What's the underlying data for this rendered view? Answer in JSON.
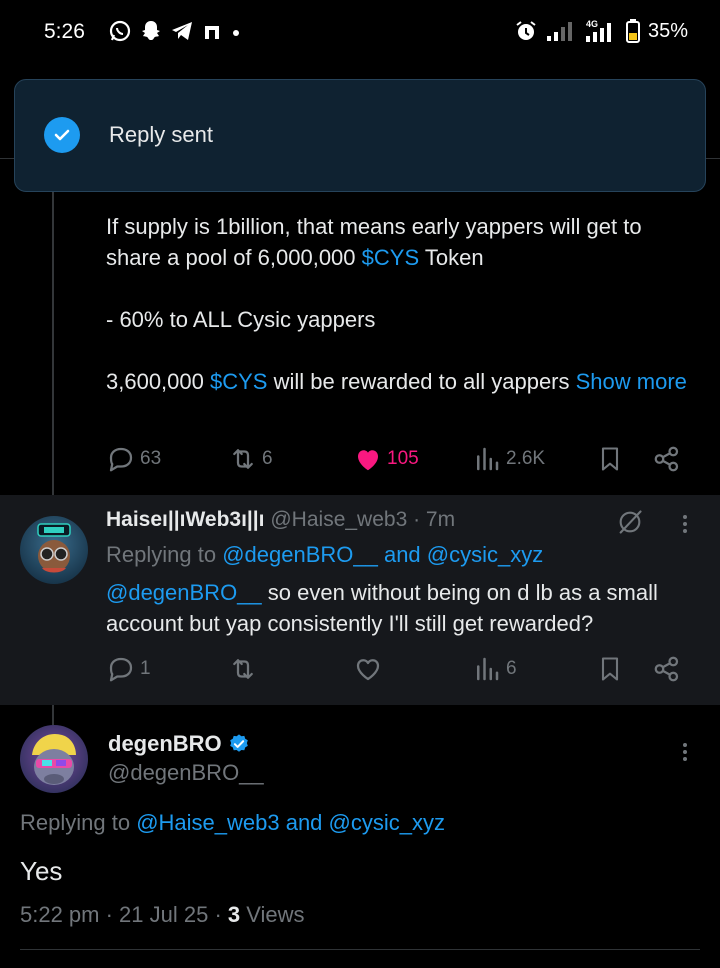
{
  "status_bar": {
    "time": "5:26",
    "network": "4G",
    "battery": "35%"
  },
  "toast": {
    "message": "Reply sent"
  },
  "parent_tweet": {
    "line1_text": "If supply is 1billion, that means early yappers will get to share a pool of 6,000,000 ",
    "line1_ticker": "$CYS",
    "line1_tail": " Token",
    "line2_text": "- 60% to ALL Cysic yappers",
    "line3_text": "3,600,000 ",
    "line3_ticker": "$CYS",
    "line3_tail": " will be rewarded to all yappers ",
    "show_more": "Show more",
    "stats": {
      "replies": "63",
      "reposts": "6",
      "likes": "105",
      "views": "2.6K"
    }
  },
  "reply_tweet": {
    "display_name": "Haiseı||ıWeb3ı||ı",
    "handle": "@Haise_web3",
    "time": "· 7m",
    "replying_prefix": "Replying to ",
    "replying_users": "@degenBRO__ and @cysic_xyz",
    "mention": "@degenBRO__",
    "body": " so even without being on d lb as a small account but yap consistently I'll still get rewarded?",
    "stats": {
      "replies": "1",
      "reposts": "",
      "likes": "",
      "views": "6"
    }
  },
  "main_tweet": {
    "display_name": "degenBRO",
    "handle": "@degenBRO__",
    "replying_prefix": "Replying to ",
    "replying_users": "@Haise_web3 and @cysic_xyz",
    "body": "Yes",
    "time": "5:22 pm · 21 Jul 25 · ",
    "views_count": "3",
    "views_label": " Views"
  },
  "colors": {
    "accent": "#1d9bf0",
    "like": "#f91880",
    "muted": "#71767b",
    "background": "#000000"
  }
}
